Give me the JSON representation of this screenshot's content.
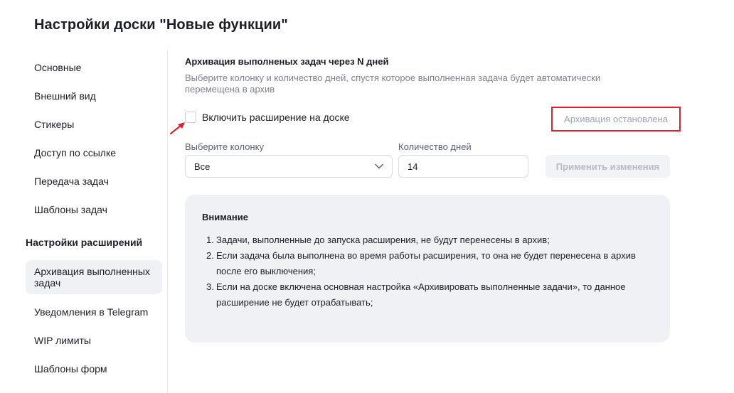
{
  "page_title": "Настройки доски \"Новые функции\"",
  "sidebar": {
    "items": [
      {
        "label": "Основные"
      },
      {
        "label": "Внешний вид"
      },
      {
        "label": "Стикеры"
      },
      {
        "label": "Доступ по ссылке"
      },
      {
        "label": "Передача задач"
      },
      {
        "label": "Шаблоны задач"
      }
    ],
    "section_heading": "Настройки расширений",
    "active_item": "Архивация выполненных задач",
    "extension_items": [
      {
        "label": "Уведомления в Telegram"
      },
      {
        "label": "WIP лимиты"
      },
      {
        "label": "Шаблоны форм"
      }
    ]
  },
  "main": {
    "section_title": "Архивация выполненых задач через N дней",
    "section_desc": "Выберите колонку и количество дней, спустя которое выполненная задача будет автоматически перемещена в архив",
    "checkbox_label": "Включить расширение на доске",
    "checkbox_checked": false,
    "status": "Архивация остановлена",
    "column_label": "Выберите колонку",
    "column_value": "Все",
    "days_label": "Количество дней",
    "days_value": "14",
    "apply_label": "Применить изменения",
    "notice": {
      "title": "Внимание",
      "items": [
        {
          "num": "1.",
          "text": "Задачи, выполненные до запуска расширения, не будут перенесены в архив;"
        },
        {
          "num": "2.",
          "text": "Если задача была выполнена во время работы расширения, то она не будет перенесена в архив после его выключения;"
        },
        {
          "num": "3.",
          "text": "Если на доске включена основная настройка «Архивировать выполненные задачи», то данное расширение не будет отрабатывать;"
        }
      ]
    }
  },
  "colors": {
    "highlight_border": "#e0202a",
    "arrow": "#e0202a"
  }
}
